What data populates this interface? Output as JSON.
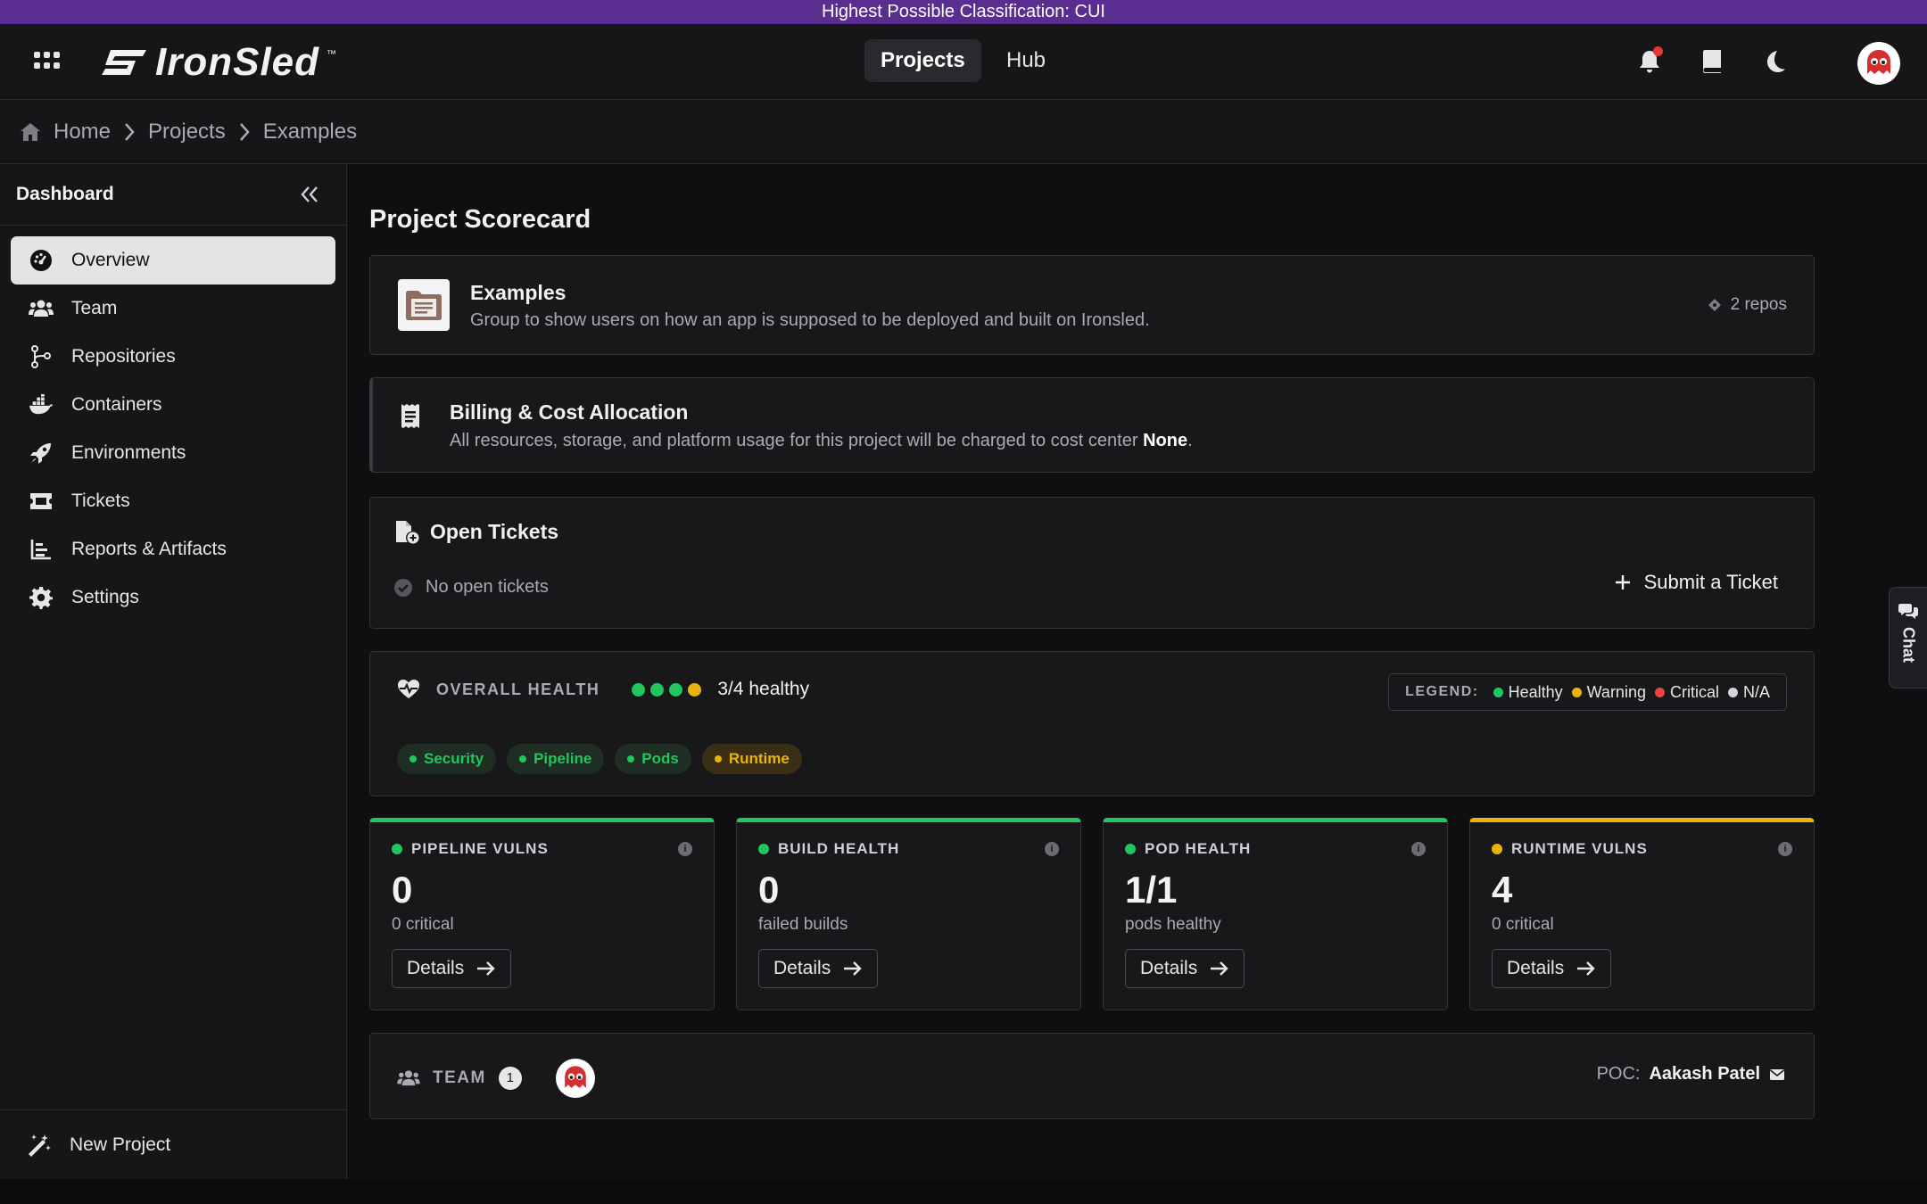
{
  "classification_banner": "Highest Possible Classification: CUI",
  "brand": {
    "name": "IronSled",
    "tm": "™"
  },
  "top_nav": {
    "tabs": [
      {
        "label": "Projects",
        "active": true
      },
      {
        "label": "Hub",
        "active": false
      }
    ]
  },
  "icons": {
    "apps": "grid-icon",
    "bell": "bell-icon",
    "docs": "book-icon",
    "theme": "moon-icon",
    "home": "home-icon"
  },
  "breadcrumb": [
    "Home",
    "Projects",
    "Examples"
  ],
  "sidebar": {
    "title": "Dashboard",
    "items": [
      {
        "label": "Overview",
        "icon": "gauge-icon",
        "active": true
      },
      {
        "label": "Team",
        "icon": "users-icon",
        "active": false
      },
      {
        "label": "Repositories",
        "icon": "git-branch-icon",
        "active": false
      },
      {
        "label": "Containers",
        "icon": "docker-icon",
        "active": false
      },
      {
        "label": "Environments",
        "icon": "rocket-icon",
        "active": false
      },
      {
        "label": "Tickets",
        "icon": "ticket-icon",
        "active": false
      },
      {
        "label": "Reports & Artifacts",
        "icon": "chart-icon",
        "active": false
      },
      {
        "label": "Settings",
        "icon": "gear-icon",
        "active": false
      }
    ],
    "footer_label": "New Project"
  },
  "page": {
    "title": "Project Scorecard",
    "project": {
      "name": "Examples",
      "description": "Group to show users on how an app is supposed to be deployed and built on Ironsled.",
      "repos": "2 repos"
    },
    "billing": {
      "title": "Billing & Cost Allocation",
      "description": "All resources, storage, and platform usage for this project will be charged to cost center",
      "cost_center": "None",
      "period": "."
    },
    "tickets": {
      "title": "Open Tickets",
      "empty": "No open tickets",
      "submit_label": "Submit a Ticket"
    },
    "health": {
      "label": "OVERALL HEALTH",
      "summary": "3/4 healthy",
      "dots": [
        "#22c55e",
        "#22c55e",
        "#22c55e",
        "#eab308"
      ],
      "legend_title": "LEGEND:",
      "legend": [
        {
          "label": "Healthy",
          "color": "#22c55e"
        },
        {
          "label": "Warning",
          "color": "#eab308"
        },
        {
          "label": "Critical",
          "color": "#ef4444"
        },
        {
          "label": "N/A",
          "color": "#d1d5db"
        }
      ],
      "pills": [
        {
          "label": "Security",
          "status": "healthy"
        },
        {
          "label": "Pipeline",
          "status": "healthy"
        },
        {
          "label": "Pods",
          "status": "healthy"
        },
        {
          "label": "Runtime",
          "status": "warning"
        }
      ]
    },
    "metrics": [
      {
        "title": "PIPELINE VULNS",
        "value": "0",
        "sub": "0 critical",
        "status": "healthy",
        "button": "Details"
      },
      {
        "title": "BUILD HEALTH",
        "value": "0",
        "sub": "failed builds",
        "status": "healthy",
        "button": "Details"
      },
      {
        "title": "POD HEALTH",
        "value": "1/1",
        "sub": "pods healthy",
        "status": "healthy",
        "button": "Details"
      },
      {
        "title": "RUNTIME VULNS",
        "value": "4",
        "sub": "0 critical",
        "status": "warning",
        "button": "Details"
      }
    ],
    "team": {
      "label": "TEAM",
      "count": "1",
      "poc_label": "POC:",
      "poc_name": "Aakash Patel"
    }
  },
  "chat_label": "Chat"
}
